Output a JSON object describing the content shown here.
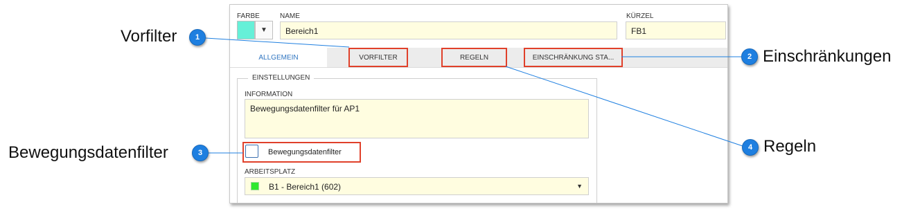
{
  "header": {
    "farbe_label": "FARBE",
    "farbe_color": "#66f0d8",
    "name_label": "NAME",
    "name_value": "Bereich1",
    "kuerzel_label": "KÜRZEL",
    "kuerzel_value": "FB1"
  },
  "tabs": [
    {
      "label": "ALLGEMEIN",
      "active": true
    },
    {
      "label": "VORFILTER",
      "highlighted": true
    },
    {
      "label": "REGELN",
      "highlighted": true
    },
    {
      "label": "EINSCHRÄNKUNG STA...",
      "highlighted": true
    }
  ],
  "settings": {
    "title": "EINSTELLUNGEN",
    "information_label": "INFORMATION",
    "information_value": "Bewegungsdatenfilter für AP1",
    "checkbox_label": "Bewegungsdatenfilter",
    "checkbox_checked": false,
    "arbeitsplatz_label": "ARBEITSPLATZ",
    "arbeitsplatz_value": "B1 - Bereich1 (602)",
    "arbeitsplatz_color": "#2ee82e"
  },
  "callouts": [
    {
      "number": "1",
      "text": "Vorfilter"
    },
    {
      "number": "2",
      "text": "Einschränkungen"
    },
    {
      "number": "3",
      "text": "Bewegungsdatenfilter"
    },
    {
      "number": "4",
      "text": "Regeln"
    }
  ],
  "colors": {
    "highlight": "#e0402a",
    "badge": "#1e7fe0",
    "field_background": "#fffde0",
    "active_tab_text": "#2e74c0"
  }
}
